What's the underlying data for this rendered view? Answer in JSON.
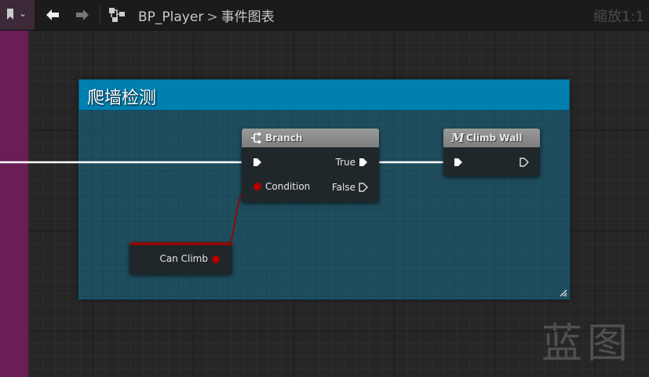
{
  "toolbar": {
    "breadcrumb_blueprint": "BP_Player",
    "breadcrumb_separator": ">",
    "breadcrumb_graph": "事件图表",
    "zoom": "缩放1:1"
  },
  "comment_box": {
    "title": "爬墙检测"
  },
  "nodes": {
    "branch": {
      "title": "Branch",
      "true_label": "True",
      "false_label": "False",
      "condition_label": "Condition"
    },
    "climb_wall": {
      "title": "Climb Wall",
      "macro_glyph": "M"
    },
    "can_climb": {
      "label": "Can Climb"
    }
  },
  "watermark": "蓝图",
  "colors": {
    "exec_wire": "#ffffff",
    "bool_pin": "#b30000",
    "comment_header": "#0080b0",
    "left_strip": "#6a1d57"
  }
}
